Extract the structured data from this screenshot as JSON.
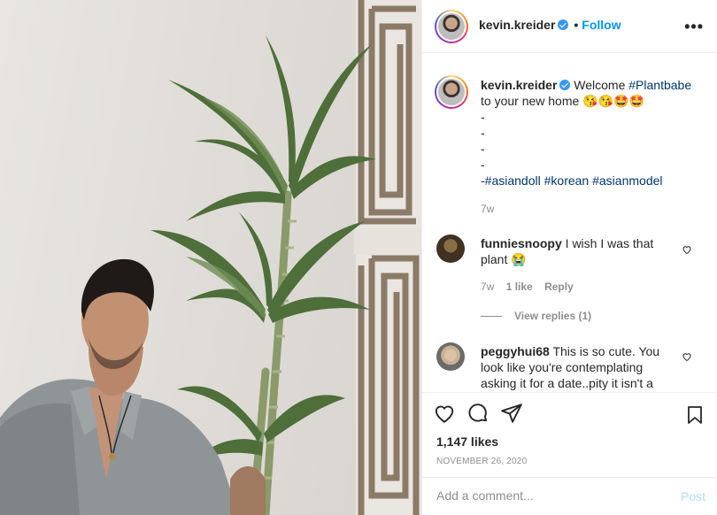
{
  "header": {
    "username": "kevin.kreider",
    "separator": "•",
    "follow_label": "Follow",
    "more_label": "•••"
  },
  "caption": {
    "username": "kevin.kreider",
    "text_1": "Welcome ",
    "hashtag_1": "#Plantbabe",
    "text_2": "to your new home 😘😘🤩🤩",
    "dashes": [
      "-",
      "-",
      "-",
      "-"
    ],
    "last_line_prefix": "-",
    "hashtags": [
      "#asiandoll",
      "#korean",
      "#asianmodel"
    ],
    "time": "7w"
  },
  "comments": [
    {
      "username": "funniesnoopy",
      "text": "I wish I was that plant 😭",
      "time": "7w",
      "likes": "1 like",
      "reply_label": "Reply",
      "view_replies": "View replies (1)"
    },
    {
      "username": "peggyhui68",
      "text": "This is so cute. You look like you're contemplating asking it for a date..pity it isn't a"
    }
  ],
  "actions": {
    "like_icon": "heart-icon",
    "comment_icon": "comment-bubble-icon",
    "share_icon": "paper-plane-icon",
    "save_icon": "bookmark-icon",
    "likes": "1,147 likes",
    "date": "NOVEMBER 26, 2020"
  },
  "add_comment": {
    "placeholder": "Add a comment...",
    "post_label": "Post"
  },
  "colors": {
    "link_blue": "#0095f6",
    "hashtag": "#00376b",
    "muted": "#8e8e8e",
    "border": "#efefef",
    "post_disabled": "#b2dffc"
  }
}
